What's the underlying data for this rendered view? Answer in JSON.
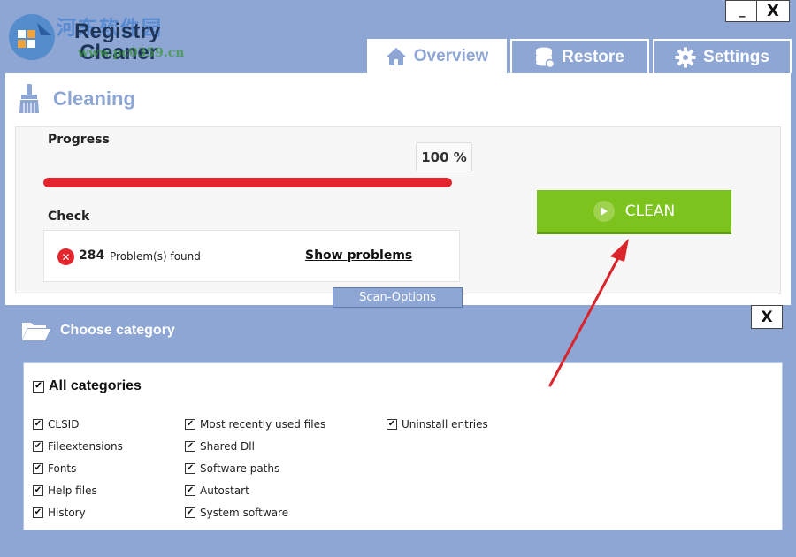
{
  "window": {
    "minimize_label": "_",
    "close_label": "X"
  },
  "logo": {
    "line1": "Registry",
    "line2": "Cleaner",
    "watermark_cn": "河东软件园",
    "watermark_url": "www.pc0359.cn"
  },
  "tabs": [
    {
      "label": "Overview",
      "icon": "home-icon",
      "active": true
    },
    {
      "label": "Restore",
      "icon": "database-icon",
      "active": false
    },
    {
      "label": "Settings",
      "icon": "gear-icon",
      "active": false
    }
  ],
  "cleaning": {
    "title": "Cleaning",
    "progress_label": "Progress",
    "progress_value": 100,
    "progress_text": "100 %",
    "check_label": "Check",
    "problem_count": "284",
    "problems_text": "Problem(s) found",
    "show_problems": "Show problems",
    "clean_button": "CLEAN",
    "scan_options": "Scan-Options"
  },
  "categories": {
    "close_label": "X",
    "title": "Choose category",
    "all_label": "All categories",
    "columns": [
      [
        "CLSID",
        "Fileextensions",
        "Fonts",
        "Help files",
        "History"
      ],
      [
        "Most recently used files",
        "Shared Dll",
        "Software paths",
        "Autostart",
        "System software"
      ],
      [
        "Uninstall entries"
      ]
    ]
  },
  "colors": {
    "accent": "#8ea6d4",
    "progress": "#e3262d",
    "clean": "#7dc31d",
    "arrow": "#d9252b"
  }
}
